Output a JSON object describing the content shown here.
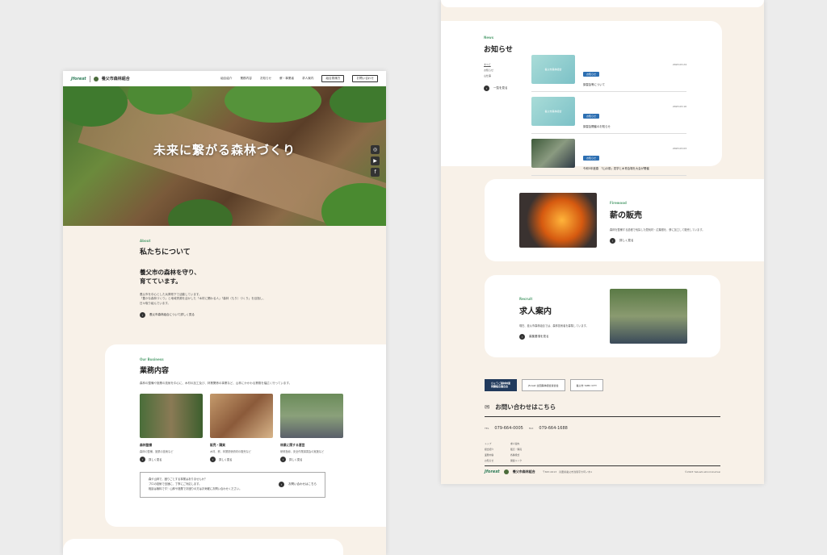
{
  "left": {
    "header": {
      "logo_mark": "Jforest",
      "logo_name": "養父市森林組合",
      "nav": [
        "組合紹介",
        "業務内容",
        "お知らせ",
        "薪・事業者",
        "求人案内"
      ],
      "btn_member": "組合員様方",
      "btn_contact": "お問い合わせ"
    },
    "hero": {
      "title": "未来に繋がる森林づくり"
    },
    "about": {
      "eyebrow": "About",
      "title": "私たちについて",
      "headline": "養父市の森林を守り、\n育てています。",
      "body": "養父市を中心とした兵庫県下で活動しています。\n「豊かな森林づくり」と地域資源を活かした「木材に関わる人」「森林（もり）づくり」を目指し、\n日々取り組んでいます。",
      "link": "養父市森林組合について詳しく見る"
    },
    "business": {
      "eyebrow": "Our Business",
      "title": "業務内容",
      "body": "森林の整備や施業の技術を中心に、木材の加工及び、林業関係の事業など、山林にかかわる業務を幅広く行っています。",
      "cards": [
        {
          "title": "森林整備",
          "desc": "森林の整備、施業の技術など",
          "link": "詳しく見る"
        },
        {
          "title": "販売・購買",
          "desc": "木材、薪、林業関係資材の販売など",
          "link": "詳しく見る"
        },
        {
          "title": "林業に関する運営",
          "desc": "研修指導、安全作業講習会の実施など",
          "link": "詳しく見る"
        }
      ],
      "contact_text": "森や山林で、困りごとする事業はありませんか？\nプロの技術で迅速に、丁寧にご対応します。\n相談は無料です！山林や施業でお困りの方はお気軽にお問い合わせください。",
      "contact_link": "お問い合わせはこちら"
    }
  },
  "right": {
    "news": {
      "eyebrow": "News",
      "title": "お知らせ",
      "filters": [
        "すべて",
        "お知らせ",
        "山仕事"
      ],
      "link": "一覧を見る",
      "items": [
        {
          "tag": "お知らせ",
          "date": "2023.03.24",
          "title": "講習会等について",
          "thumb": "養父市森林組合"
        },
        {
          "tag": "お知らせ",
          "date": "2023.03.10",
          "title": "講習会開催のお知らせ",
          "thumb": "養父市森林組合"
        },
        {
          "tag": "お知らせ",
          "date": "2023.03.03",
          "title": "令和5年度春　「山の祭」見学と木育会場を大会が開催",
          "thumb": ""
        }
      ]
    },
    "firewood": {
      "eyebrow": "Firewood",
      "title": "薪の販売",
      "body": "森林を整備する過程で伐採した間伐材・広葉樹を、薪に加工して販売しています。",
      "link": "詳しく見る"
    },
    "recruit": {
      "eyebrow": "Recruit",
      "title": "求人案内",
      "body": "現在、養父市森林組合では、森林技術者を募集しています。",
      "link": "募集要項を見る"
    },
    "footer": {
      "btn1": "ひょうご森林林業\n同職組合連合会",
      "btn2": "Jforest 全国森林組合連合会",
      "btn3": "養父市 YABU CITY",
      "contact_title": "お問い合わせはこちら",
      "tel_label": "TEL",
      "tel": "079-664-0005",
      "fax_label": "FAX",
      "fax": "079-664-1688",
      "menu": [
        "トップ",
        "求人案内",
        "組合紹介",
        "販売・購買",
        "業務内容",
        "各種様式",
        "お知らせ",
        "関連リンク"
      ],
      "address": "〒667-0013　兵庫県養父市浅間字大坪ノ木1",
      "copyright": "©2023 Yabushi-shinrinkumiai"
    }
  }
}
